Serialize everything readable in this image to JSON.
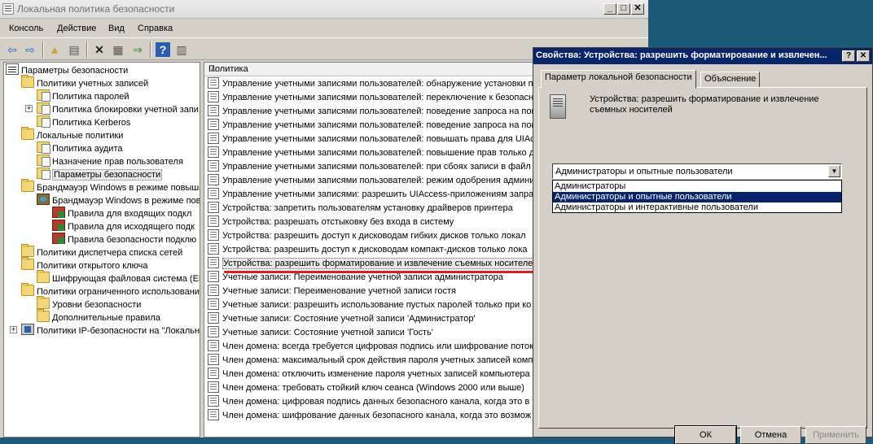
{
  "main_window": {
    "title": "Локальная политика безопасности",
    "controls": {
      "minimize": "_",
      "maximize": "□",
      "close": "✕"
    }
  },
  "menu": [
    "Консоль",
    "Действие",
    "Вид",
    "Справка"
  ],
  "toolbar_icons": [
    "back-arrow-icon",
    "forward-arrow-icon",
    "up-folder-icon",
    "show-hide-tree-icon",
    "delete-icon",
    "properties-icon",
    "export-list-icon",
    "help-icon",
    "show-hide-action-pane-icon"
  ],
  "tree": {
    "items": [
      {
        "label": "Параметры безопасности",
        "icon": "root-icon"
      },
      {
        "label": "Политики учетных записей",
        "icon": "folder-icon"
      },
      {
        "label": "Политика паролей",
        "icon": "policy-folder-icon"
      },
      {
        "label": "Политика блокировки учетной запи",
        "icon": "policy-folder-icon"
      },
      {
        "label": "Политика Kerberos",
        "icon": "policy-folder-icon"
      },
      {
        "label": "Локальные политики",
        "icon": "folder-icon"
      },
      {
        "label": "Политика аудита",
        "icon": "policy-folder-icon"
      },
      {
        "label": "Назначение прав пользователя",
        "icon": "policy-folder-icon"
      },
      {
        "label": "Параметры безопасности",
        "icon": "policy-folder-icon"
      },
      {
        "label": "Брандмауэр Windows в режиме повыше",
        "icon": "folder-icon"
      },
      {
        "label": "Брандмауэр Windows в режиме пов",
        "icon": "firewall-icon"
      },
      {
        "label": "Правила для входящих подкл",
        "icon": "rule-icon"
      },
      {
        "label": "Правила для исходящего подк",
        "icon": "rule-icon"
      },
      {
        "label": "Правила безопасности подклю",
        "icon": "rule-icon"
      },
      {
        "label": "Политики диспетчера списка сетей",
        "icon": "folder-icon"
      },
      {
        "label": "Политики открытого ключа",
        "icon": "folder-icon"
      },
      {
        "label": "Шифрующая файловая система (EF",
        "icon": "folder-icon"
      },
      {
        "label": "Политики ограниченного использовани",
        "icon": "folder-icon"
      },
      {
        "label": "Уровни безопасности",
        "icon": "folder-icon"
      },
      {
        "label": "Дополнительные правила",
        "icon": "folder-icon"
      },
      {
        "label": "Политики IP-безопасности на \"Локальн",
        "icon": "ipsec-icon"
      }
    ]
  },
  "list": {
    "column_header": "Политика",
    "rows": [
      "Управление учетными записями пользователей: обнаружение установки прил",
      "Управление учетными записями пользователей: переключение к безопасному",
      "Управление учетными записями пользователей: поведение запроса на повыш",
      "Управление учетными записями пользователей: поведение запроса на повыш",
      "Управление учетными записями пользователей: повышать права для UIAccess",
      "Управление учетными записями пользователей: повышение прав только для",
      "Управление учетными записями пользователей: при сбоях записи в файл",
      "Управление учетными записями пользователей: режим одобрения администр",
      "Управление учетными записями: разрешить UIAccess-приложениям запраш",
      "Устройства: запретить пользователям установку драйверов принтера",
      "Устройства: разрешать отстыковку без входа в систему",
      "Устройства: разрешить доступ к дисководам гибких дисков только локал",
      "Устройства: разрешить доступ к дисководам компакт-дисков только лока",
      "Устройства: разрешить форматирование и извлечение съемных носителей",
      "Учетные записи: Переименование учетной записи администратора",
      "Учетные записи: Переименование учетной записи гостя",
      "Учетные записи: разрешить использование пустых паролей только при ко",
      "Учетные записи: Состояние учетной записи 'Администратор'",
      "Учетные записи: Состояние учетной записи 'Гость'",
      "Член домена: всегда требуется цифровая подпись или шифрование потока",
      "Член домена: максимальный срок действия пароля учетных записей компь",
      "Член домена: отключить изменение пароля учетных записей компьютера",
      "Член домена: требовать стойкий ключ сеанса (Windows 2000 или выше)",
      "Член домена: цифровая подпись данных безопасного канала, когда это в",
      "Член домена: шифрование данных безопасного канала, когда это возмож"
    ]
  },
  "dialog": {
    "title": "Свойства: Устройства: разрешить форматирование и извлечен...",
    "controls": {
      "help": "?",
      "close": "✕"
    },
    "tabs": [
      "Параметр локальной безопасности",
      "Объяснение"
    ],
    "setting_title": "Устройства: разрешить форматирование и извлечение съемных носителей",
    "combo_value": "Администраторы и опытные пользователи",
    "options": [
      "Администраторы",
      "Администраторы и опытные пользователи",
      "Администраторы и интерактивные пользователи"
    ],
    "selected_option_index": 1,
    "buttons": {
      "ok": "ОК",
      "cancel": "Отмена",
      "apply": "Применить"
    }
  }
}
